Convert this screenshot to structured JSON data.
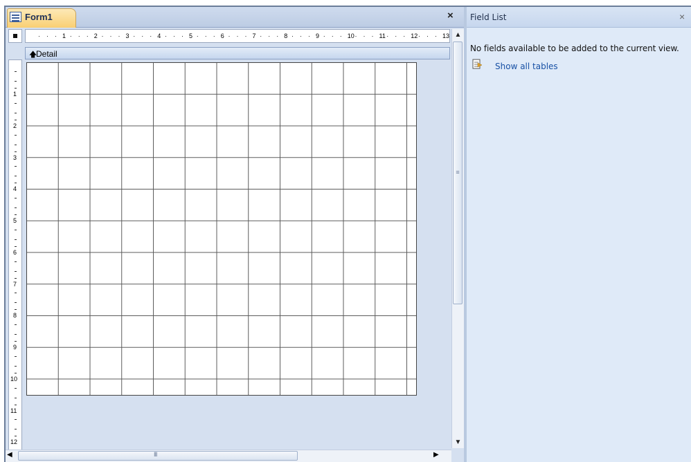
{
  "document": {
    "tab_title": "Form1",
    "close_symbol": "×",
    "section_label": "Detail",
    "section_icon": "up-arrow-icon",
    "tab_icon": "form-icon"
  },
  "ruler": {
    "horizontal_labels": [
      "1",
      "2",
      "3",
      "4",
      "5",
      "6",
      "7",
      "8",
      "9",
      "10",
      "11",
      "12",
      "13"
    ],
    "vertical_labels": [
      "1",
      "2",
      "3",
      "4",
      "5",
      "6",
      "7",
      "8",
      "9",
      "10",
      "11",
      "12"
    ]
  },
  "scrollbar": {
    "up": "▲",
    "down": "▼",
    "left": "◀",
    "right": "▶",
    "grip_v": "≡",
    "grip_h": "III"
  },
  "field_list": {
    "title": "Field List",
    "close_symbol": "×",
    "message": "No fields available to be added to the current view.",
    "link_label": "Show all tables",
    "link_icon": "table-icon"
  }
}
